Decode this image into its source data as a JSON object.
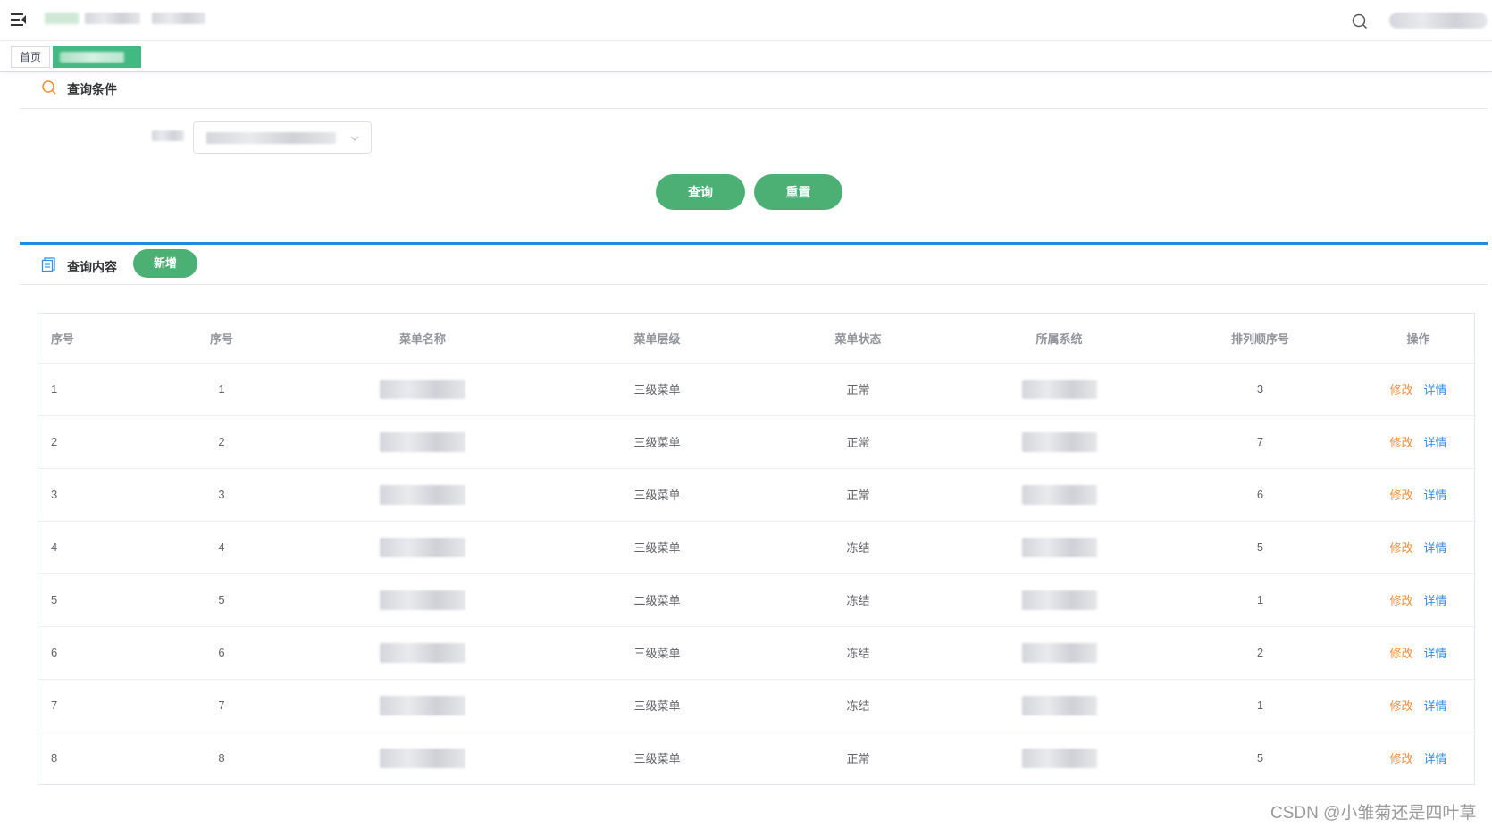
{
  "breadcrumb_tags": {
    "home": "首页"
  },
  "query_section": {
    "title": "查询条件"
  },
  "buttons": {
    "query": "查询",
    "reset": "重置",
    "add": "新增"
  },
  "content_section": {
    "title": "查询内容"
  },
  "table": {
    "headers": [
      "序号",
      "序号",
      "菜单名称",
      "菜单层级",
      "菜单状态",
      "所属系统",
      "排列顺序号",
      "操作"
    ],
    "rows": [
      {
        "idx": "1",
        "no": "1",
        "level": "三级菜单",
        "status": "正常",
        "order": "3"
      },
      {
        "idx": "2",
        "no": "2",
        "level": "三级菜单",
        "status": "正常",
        "order": "7"
      },
      {
        "idx": "3",
        "no": "3",
        "level": "三级菜单",
        "status": "正常",
        "order": "6"
      },
      {
        "idx": "4",
        "no": "4",
        "level": "三级菜单",
        "status": "冻结",
        "order": "5"
      },
      {
        "idx": "5",
        "no": "5",
        "level": "二级菜单",
        "status": "冻结",
        "order": "1"
      },
      {
        "idx": "6",
        "no": "6",
        "level": "三级菜单",
        "status": "冻结",
        "order": "2"
      },
      {
        "idx": "7",
        "no": "7",
        "level": "三级菜单",
        "status": "冻结",
        "order": "1"
      },
      {
        "idx": "8",
        "no": "8",
        "level": "三级菜单",
        "status": "正常",
        "order": "5"
      }
    ],
    "actions": {
      "edit": "修改",
      "detail": "详情"
    }
  },
  "watermark": "CSDN @小雏菊还是四叶草",
  "colors": {
    "accent_green": "#4cb074",
    "tag_green": "#42b983",
    "divider_blue": "#1e88e5",
    "edit_orange": "#f08c3a",
    "detail_blue": "#3a8ee6"
  },
  "icons": {
    "menu": "hamburger-icon",
    "search": "search-icon",
    "query_section": "search-icon",
    "content_section": "document-icon",
    "select": "chevron-down-icon"
  }
}
